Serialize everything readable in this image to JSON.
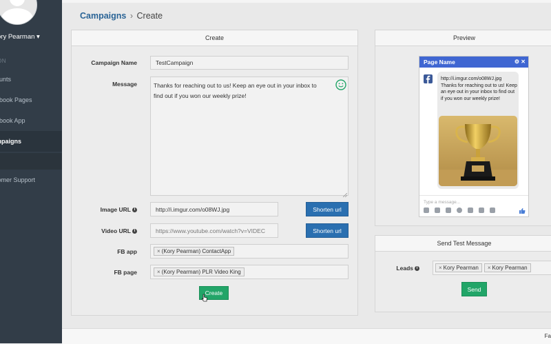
{
  "sidebar": {
    "user_name": "ory Pearman",
    "caret": "▾",
    "section_header": "ON",
    "items": [
      {
        "label": "ounts"
      },
      {
        "label": "ebook Pages"
      },
      {
        "label": "ebook App"
      },
      {
        "label": "mpaigns"
      },
      {
        "label": "tomer Support"
      }
    ]
  },
  "breadcrumb": {
    "link": "Campaigns",
    "separator": "›",
    "current": "Create"
  },
  "create_panel": {
    "heading": "Create",
    "campaign_name": {
      "label": "Campaign Name",
      "value": "TestCampaign"
    },
    "message": {
      "label": "Message",
      "value": "Thanks for reaching out to us! Keep an eye out in your inbox to find out if you won our weekly prize!"
    },
    "image_url": {
      "label": "Image URL",
      "value": "http://i.imgur.com/o08WJ.jpg",
      "button": "Shorten url"
    },
    "video_url": {
      "label": "Video URL",
      "placeholder": "https://www.youtube.com/watch?v=VIDEC",
      "button": "Shorten url"
    },
    "fb_app": {
      "label": "FB app",
      "tag": "(Kory Pearman) ContactApp"
    },
    "fb_page": {
      "label": "FB page",
      "tag": "(Kory Pearman) PLR Video King"
    },
    "tag_remove": "×",
    "create_button": "Create",
    "info_glyph": "i"
  },
  "preview_panel": {
    "heading": "Preview",
    "chat": {
      "title": "Page Name",
      "header_icons": "⚙ ✕",
      "message": "http://i.imgur.com/o08WJ.jpg Thanks for reaching out to us! Keep an eye out in your inbox to find out if you won our weekly prize!",
      "input_placeholder": "Type a message..."
    }
  },
  "test_panel": {
    "heading": "Send Test Message",
    "leads_label": "Leads",
    "leads": [
      "Kory Pearman",
      "Kory Pearman"
    ],
    "send_button": "Send"
  },
  "footer": {
    "text": "Fa"
  },
  "colors": {
    "sidebar": "#323d48",
    "link": "#2a6496",
    "primary": "#2a6fb0",
    "success": "#22a568",
    "messenger": "#3f66d2"
  }
}
